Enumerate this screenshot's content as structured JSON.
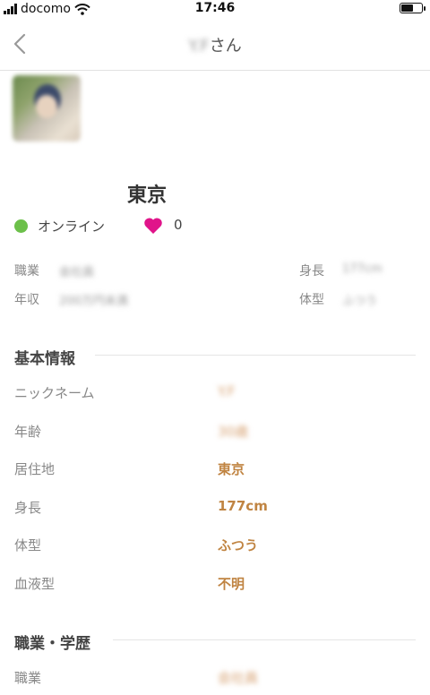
{
  "status_bar": {
    "carrier": "docomo",
    "time": "17:46",
    "battery_level": 0.6
  },
  "nav": {
    "title_name": "Y.F",
    "title_suffix": "さん"
  },
  "profile": {
    "location": "東京",
    "online_label": "オンライン",
    "like_count": "0"
  },
  "summary": {
    "occupation_label": "職業",
    "occupation_value": "会社員",
    "income_label": "年収",
    "income_value": "200万円未満",
    "height_label": "身長",
    "height_value": "177cm",
    "body_label": "体型",
    "body_value": "ふつう"
  },
  "basic_info": {
    "heading": "基本情報",
    "rows": [
      {
        "label": "ニックネーム",
        "value": "Y.F"
      },
      {
        "label": "年齢",
        "value": "30歳"
      },
      {
        "label": "居住地",
        "value": "東京"
      },
      {
        "label": "身長",
        "value": "177cm"
      },
      {
        "label": "体型",
        "value": "ふつう"
      },
      {
        "label": "血液型",
        "value": "不明"
      }
    ]
  },
  "career": {
    "heading": "職業・学歴",
    "rows": [
      {
        "label": "職業",
        "value": "会社員"
      }
    ]
  },
  "colors": {
    "accent": "#c08442",
    "online": "#6cc04a",
    "heart": "#e0148a"
  }
}
